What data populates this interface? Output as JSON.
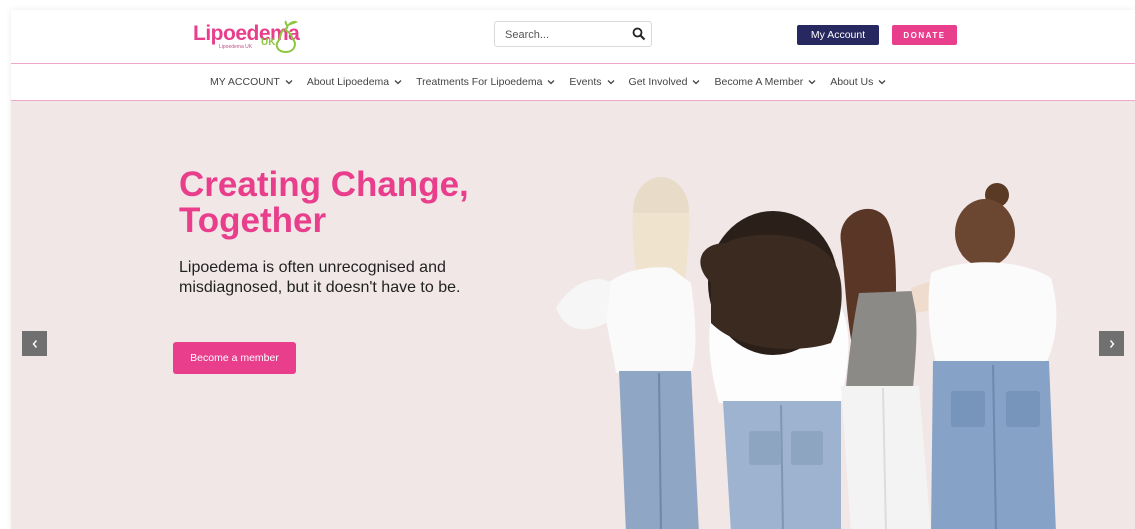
{
  "brand": {
    "name": "Lipoedema",
    "suffix": "UK",
    "tagline": "Lipoedema UK",
    "pink": "#e83e8c",
    "green": "#8cc63f",
    "navy": "#27285f"
  },
  "search": {
    "placeholder": "Search...",
    "value": ""
  },
  "header": {
    "account_label": "My Account",
    "donate_label": "DONATE"
  },
  "nav": {
    "items": [
      {
        "label": "MY ACCOUNT"
      },
      {
        "label": "About Lipoedema"
      },
      {
        "label": "Treatments For Lipoedema"
      },
      {
        "label": "Events"
      },
      {
        "label": "Get Involved"
      },
      {
        "label": "Become A Member"
      },
      {
        "label": "About Us"
      }
    ]
  },
  "hero": {
    "title": "Creating Change, Together",
    "subtitle": "Lipoedema is often unrecognised and misdiagnosed, but it doesn't have to be.",
    "cta_label": "Become a member",
    "background": "#f1e7e7"
  },
  "slider": {
    "prev_icon": "‹",
    "next_icon": "›"
  }
}
